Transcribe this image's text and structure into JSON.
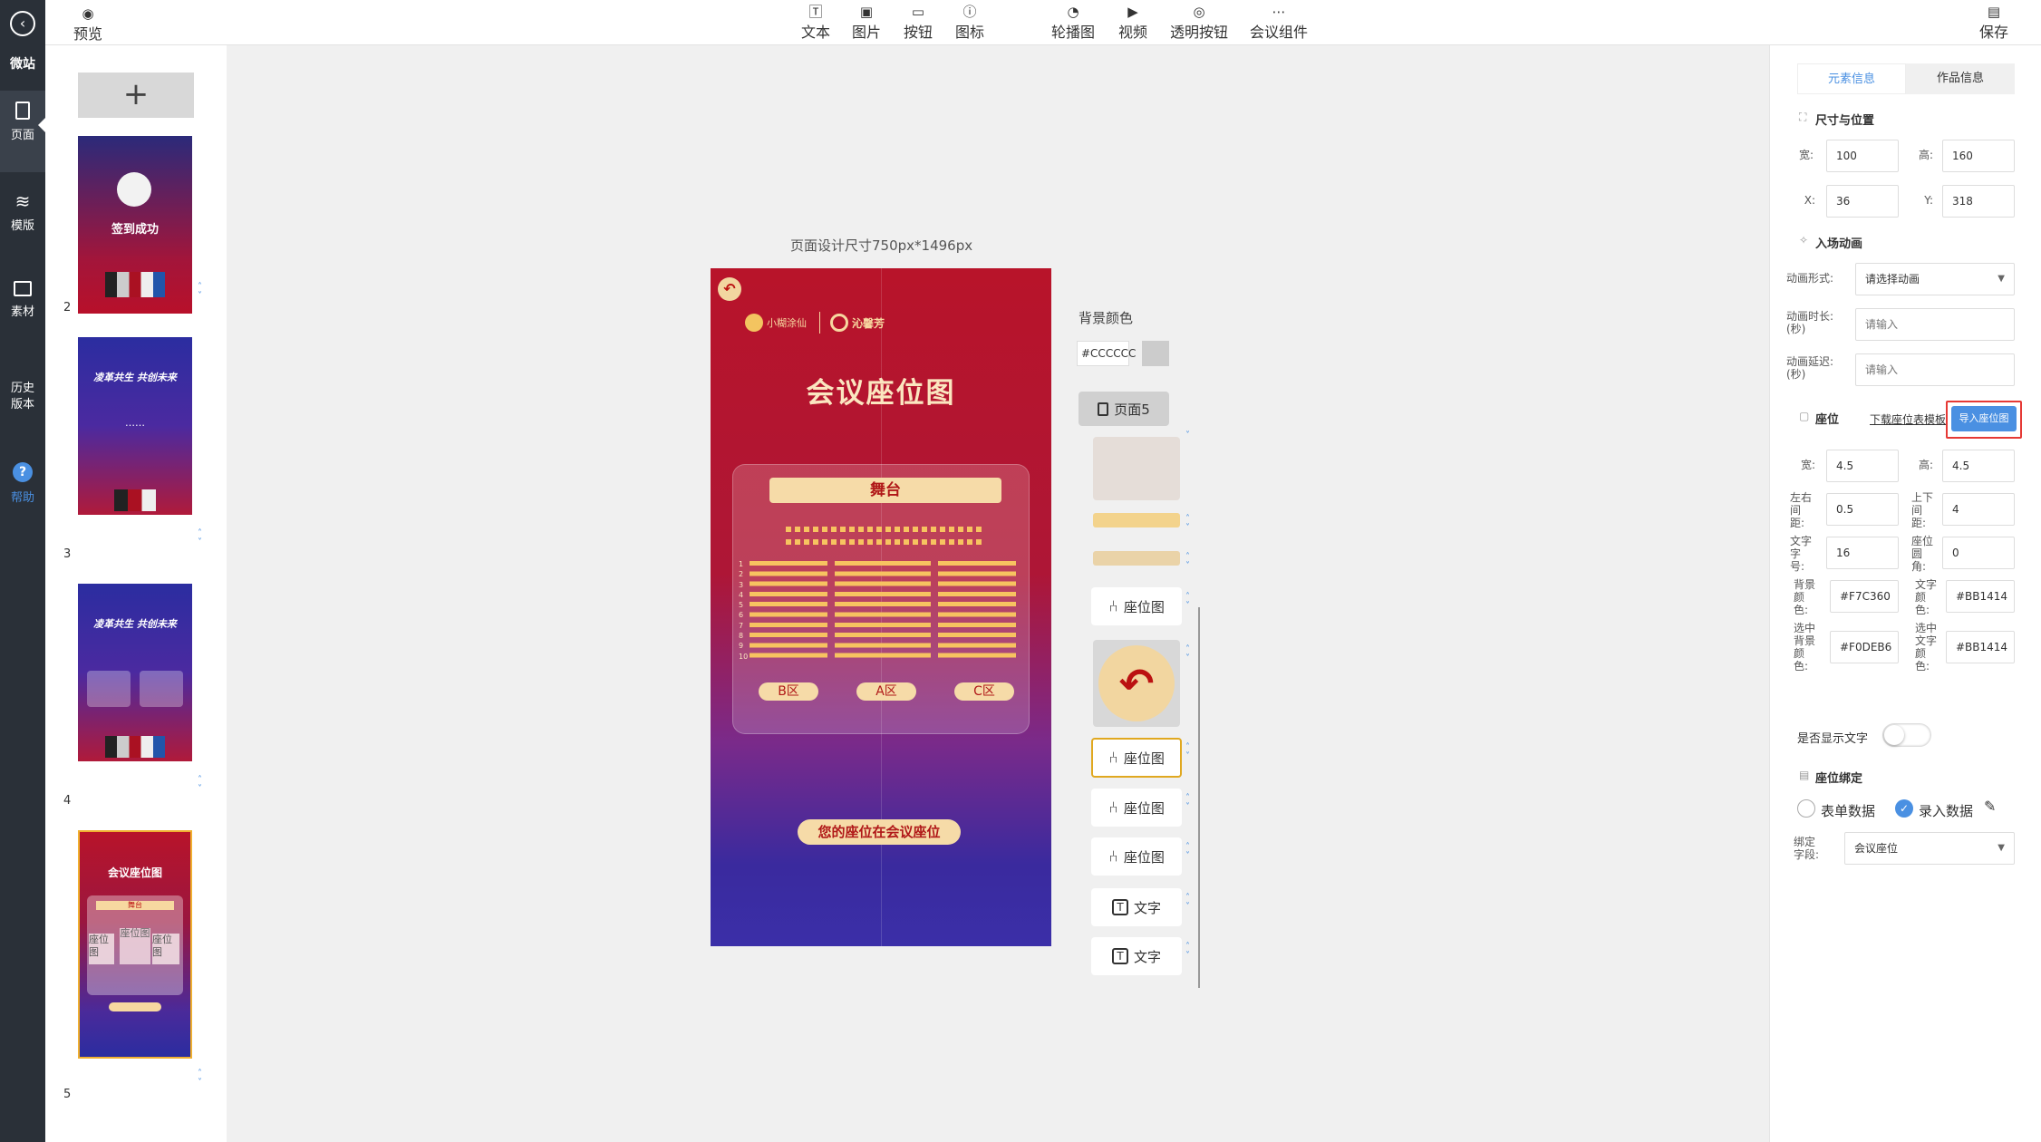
{
  "left_nav": {
    "brand": "微站",
    "items": [
      {
        "label": "页面",
        "icon": "page-icon"
      },
      {
        "label": "模版",
        "icon": "layers-icon"
      },
      {
        "label": "素材",
        "icon": "image-icon"
      },
      {
        "label": "历史版本",
        "icon": "history-icon"
      },
      {
        "label": "帮助",
        "icon": "help-icon"
      }
    ]
  },
  "toolbar": {
    "preview": "预览",
    "save": "保存",
    "tools": [
      "文本",
      "图片",
      "按钮",
      "图标",
      "轮播图",
      "视频",
      "透明按钮",
      "会议组件"
    ]
  },
  "thumbnails": {
    "add": "+",
    "pages": [
      {
        "num": "2",
        "line1": "签到成功"
      },
      {
        "num": "3",
        "line1": "凌革共生 共创未来",
        "dots": "……"
      },
      {
        "num": "4",
        "line1": "凌革共生 共创未来"
      },
      {
        "num": "5",
        "line1": "会议座位图",
        "stage": "舞台",
        "seat1": "座位图",
        "seat2": "座位图",
        "seat3": "座位图"
      }
    ]
  },
  "canvas": {
    "size_label": "页面设计尺寸750px*1496px",
    "title": "会议座位图",
    "stage": "舞台",
    "brand1": "小糊涂仙",
    "brand2": "沁馨芳",
    "zones": [
      "B区",
      "A区",
      "C区"
    ],
    "banner": "您的座位在会议座位",
    "rows": [
      "1",
      "2",
      "3",
      "4",
      "5",
      "6",
      "7",
      "8",
      "9",
      "10"
    ]
  },
  "layers": {
    "bg_label": "背景颜色",
    "bg_value": "#CCCCCC",
    "page_label": "页面5",
    "items": [
      "座位图",
      "座位图",
      "座位图",
      "座位图",
      "文字",
      "文字"
    ]
  },
  "panel": {
    "tabs": [
      "元素信息",
      "作品信息"
    ],
    "size_section": "尺寸与位置",
    "width_label": "宽:",
    "width": "100",
    "height_label": "高:",
    "height": "160",
    "x_label": "X:",
    "x": "36",
    "y_label": "Y:",
    "y": "318",
    "anim_section": "入场动画",
    "anim_form_label": "动画形式:",
    "anim_form_value": "请选择动画",
    "anim_dur_label": "动画时长:(秒)",
    "anim_dur_ph": "请输入",
    "anim_delay_label": "动画延迟:(秒)",
    "anim_delay_ph": "请输入",
    "seat_section": "座位",
    "download_link": "下载座位表模板",
    "import_btn": "导入座位图",
    "seat_w_label": "宽:",
    "seat_w": "4.5",
    "seat_h_label": "高:",
    "seat_h": "4.5",
    "lr_label": "左右间距:",
    "lr": "0.5",
    "ud_label": "上下间距:",
    "ud": "4",
    "font_label": "文字字号:",
    "font": "16",
    "radius_label": "座位圆角:",
    "radius": "0",
    "bgc_label": "背景颜色:",
    "bgc": "#F7C360",
    "txtc_label": "文字颜色:",
    "txtc": "#BB1414",
    "selbg_label": "选中背景颜色:",
    "selbg": "#F0DEB6",
    "seltxt_label": "选中文字颜色:",
    "seltxt": "#BB1414",
    "show_text_label": "是否显示文字",
    "bind_section": "座位绑定",
    "radio1": "表单数据",
    "radio2": "录入数据",
    "bind_field_label": "绑定字段:",
    "bind_field_value": "会议座位"
  },
  "colors": {
    "accent": "#4a90e2",
    "nav_bg": "#2a3038",
    "seat": "#F7C360",
    "highlight": "#e53935"
  }
}
